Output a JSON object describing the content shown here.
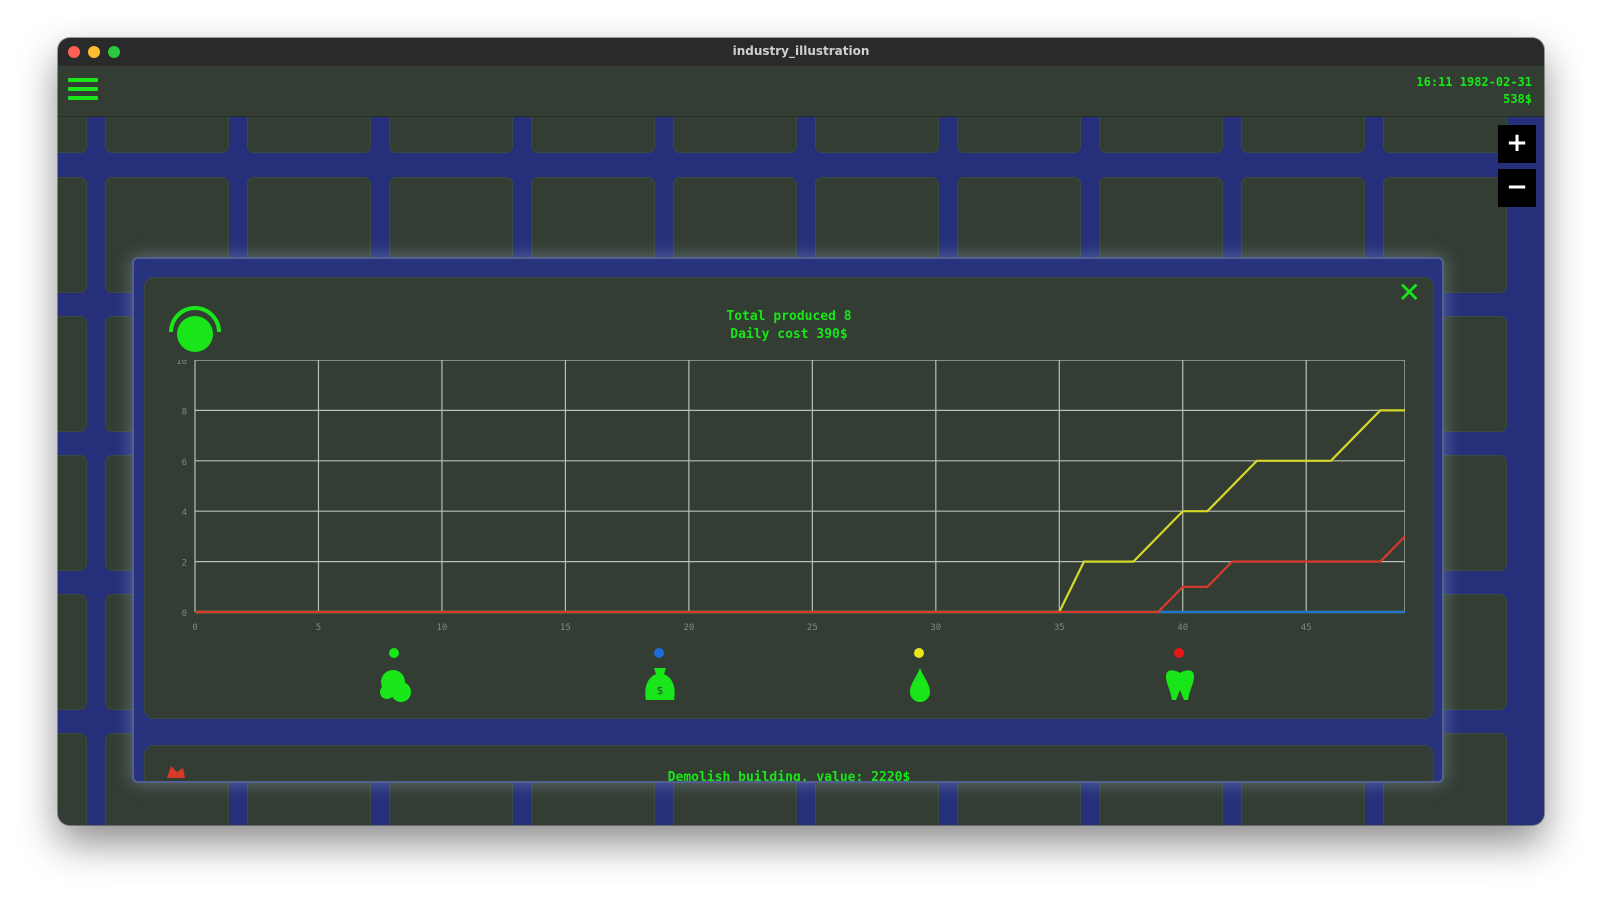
{
  "window": {
    "title": "industry_illustration"
  },
  "header": {
    "menu_icon": "hamburger-icon",
    "datetime": "16:11  1982-02-31",
    "money": "538$"
  },
  "map_controls": {
    "zoom_in": "+",
    "zoom_out": "−"
  },
  "dialog": {
    "close_label": "✕",
    "gauge_icon": "gauge-icon",
    "total_produced": "Total produced 8",
    "daily_cost": "Daily cost 390$",
    "resources": [
      {
        "name": "ore",
        "icon": "ore-icon",
        "color": "#19e619"
      },
      {
        "name": "bag",
        "icon": "bag-icon",
        "color": "#1e6cd8"
      },
      {
        "name": "drop",
        "icon": "drop-icon",
        "color": "#e6e619"
      },
      {
        "name": "tooth",
        "icon": "tooth-icon",
        "color": "#e61919"
      }
    ],
    "bottom_panel_text": "Demolish building, value: 2220$"
  },
  "chart_data": {
    "type": "line",
    "xlim": [
      0,
      49
    ],
    "ylim": [
      0,
      10
    ],
    "xticks": [
      0,
      5,
      10,
      15,
      20,
      25,
      30,
      35,
      40,
      45
    ],
    "yticks": [
      0,
      2,
      4,
      6,
      8,
      10
    ],
    "grid": true,
    "series": [
      {
        "color": "#19e619",
        "points": [
          [
            0,
            0
          ],
          [
            49,
            0
          ]
        ]
      },
      {
        "color": "#2a6fd6",
        "points": [
          [
            0,
            0
          ],
          [
            49,
            0
          ]
        ]
      },
      {
        "color": "#d8d82a",
        "points": [
          [
            0,
            0
          ],
          [
            35,
            0
          ],
          [
            36,
            2
          ],
          [
            38,
            2
          ],
          [
            40,
            4
          ],
          [
            41,
            4
          ],
          [
            43,
            6
          ],
          [
            46,
            6
          ],
          [
            48,
            8
          ],
          [
            49,
            8
          ]
        ]
      },
      {
        "color": "#d83a2a",
        "points": [
          [
            0,
            0
          ],
          [
            39,
            0
          ],
          [
            40,
            1
          ],
          [
            41,
            1
          ],
          [
            42,
            2
          ],
          [
            48,
            2
          ],
          [
            49,
            3
          ]
        ]
      }
    ]
  }
}
